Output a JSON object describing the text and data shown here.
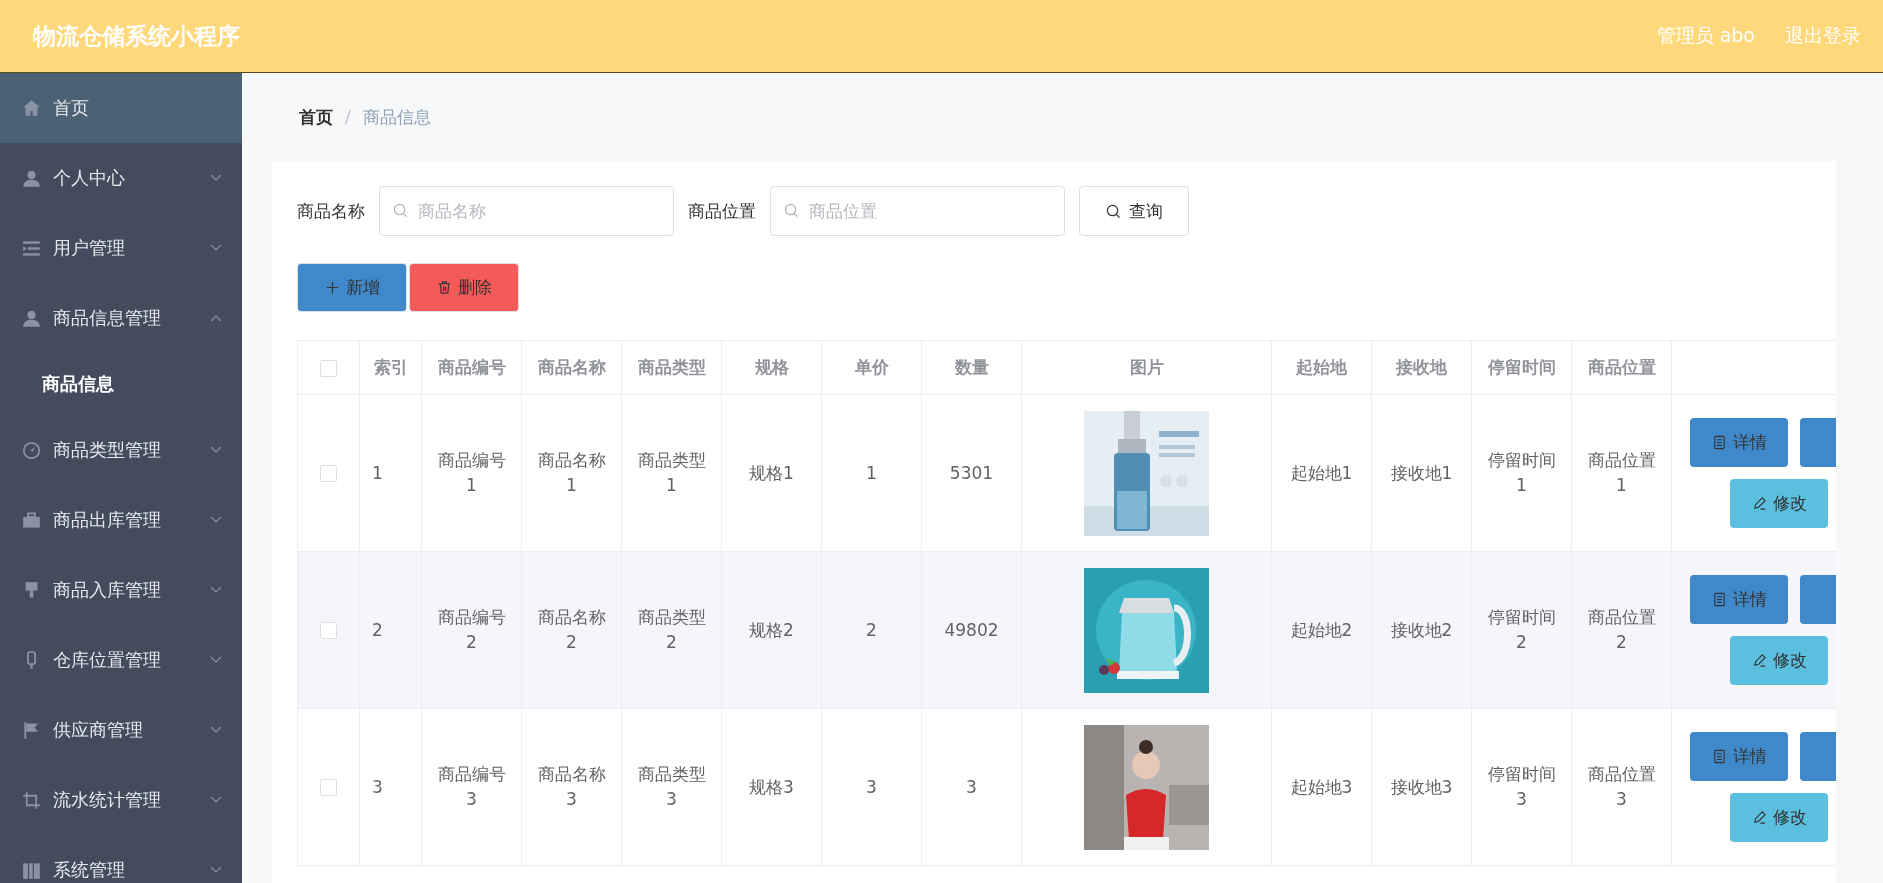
{
  "header": {
    "title": "物流仓储系统小程序",
    "user": "管理员 abo",
    "logout": "退出登录"
  },
  "sidebar": {
    "items": [
      {
        "label": "首页",
        "selected": true
      },
      {
        "label": "个人中心",
        "selected": false,
        "expanded": false
      },
      {
        "label": "用户管理",
        "selected": false,
        "expanded": false
      },
      {
        "label": "商品信息管理",
        "selected": false,
        "expanded": true,
        "children": [
          {
            "label": "商品信息",
            "selected": true
          }
        ]
      },
      {
        "label": "商品类型管理",
        "selected": false,
        "expanded": false
      },
      {
        "label": "商品出库管理",
        "selected": false,
        "expanded": false
      },
      {
        "label": "商品入库管理",
        "selected": false,
        "expanded": false
      },
      {
        "label": "仓库位置管理",
        "selected": false,
        "expanded": false
      },
      {
        "label": "供应商管理",
        "selected": false,
        "expanded": false
      },
      {
        "label": "流水统计管理",
        "selected": false,
        "expanded": false
      },
      {
        "label": "系统管理",
        "selected": false,
        "expanded": false
      }
    ]
  },
  "breadcrumb": {
    "items": [
      "首页",
      "商品信息"
    ],
    "separator": "/"
  },
  "search": {
    "fields": [
      {
        "label": "商品名称",
        "placeholder": "商品名称"
      },
      {
        "label": "商品位置",
        "placeholder": "商品位置"
      }
    ],
    "button": "查询"
  },
  "actions": [
    {
      "kind": "add",
      "label": "新增"
    },
    {
      "kind": "delete",
      "label": "删除"
    }
  ],
  "table": {
    "header_checked": false,
    "columns": [
      "索引",
      "商品编号",
      "商品名称",
      "商品类型",
      "规格",
      "单价",
      "数量",
      "图片",
      "起始地",
      "接收地",
      "停留时间",
      "商品位置"
    ],
    "rows": [
      {
        "checked": false,
        "cells": [
          "1",
          "商品编号1",
          "商品名称1",
          "商品类型1",
          "规格1",
          "1",
          "5301",
          {
            "kind": "picture"
          },
          "起始地1",
          "接收地1",
          "停留时间1",
          "商品位置1"
        ],
        "buttons": [
          {
            "kind": "details",
            "label": "详情"
          },
          {
            "kind": "other"
          },
          {
            "kind": "edit",
            "label": "修改"
          }
        ]
      },
      {
        "checked": false,
        "cells": [
          "2",
          "商品编号2",
          "商品名称2",
          "商品类型2",
          "规格2",
          "2",
          "49802",
          {
            "kind": "picture"
          },
          "起始地2",
          "接收地2",
          "停留时间2",
          "商品位置2"
        ],
        "buttons": [
          {
            "kind": "details",
            "label": "详情"
          },
          {
            "kind": "other"
          },
          {
            "kind": "edit",
            "label": "修改"
          }
        ]
      },
      {
        "checked": false,
        "cells": [
          "3",
          "商品编号3",
          "商品名称3",
          "商品类型3",
          "规格3",
          "3",
          "3",
          {
            "kind": "picture"
          },
          "起始地3",
          "接收地3",
          "停留时间3",
          "商品位置3"
        ],
        "buttons": [
          {
            "kind": "details",
            "label": "详情"
          },
          {
            "kind": "other"
          },
          {
            "kind": "edit",
            "label": "修改"
          }
        ]
      }
    ]
  }
}
